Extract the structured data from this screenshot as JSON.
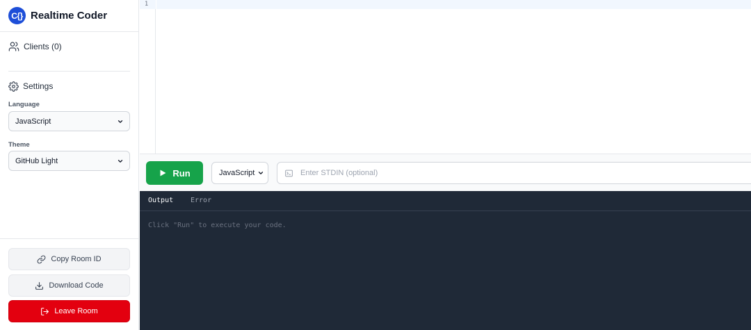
{
  "brand": {
    "logo": "C{}",
    "title": "Realtime Coder",
    "color": "#1d4ed8"
  },
  "sidebar": {
    "clients_label": "Clients (0)",
    "settings_label": "Settings",
    "language_label": "Language",
    "language_value": "JavaScript",
    "theme_label": "Theme",
    "theme_value": "GitHub Light",
    "copy_label": "Copy Room ID",
    "download_label": "Download Code",
    "leave_label": "Leave Room"
  },
  "editor": {
    "line_numbers": [
      "1"
    ],
    "content": ""
  },
  "toolbar": {
    "run_label": "Run",
    "language_value": "JavaScript",
    "stdin_placeholder": "Enter STDIN (optional)"
  },
  "output": {
    "tabs": [
      {
        "label": "Output",
        "active": true
      },
      {
        "label": "Error",
        "active": false
      }
    ],
    "message": "Click \"Run\" to execute your code."
  },
  "colors": {
    "run": "#16a34a",
    "leave": "#e3000f",
    "output_bg": "#1f2937"
  },
  "icons": [
    "users-icon",
    "gear-icon",
    "chevron-down-icon",
    "link-icon",
    "download-icon",
    "logout-icon",
    "play-icon",
    "terminal-icon"
  ]
}
